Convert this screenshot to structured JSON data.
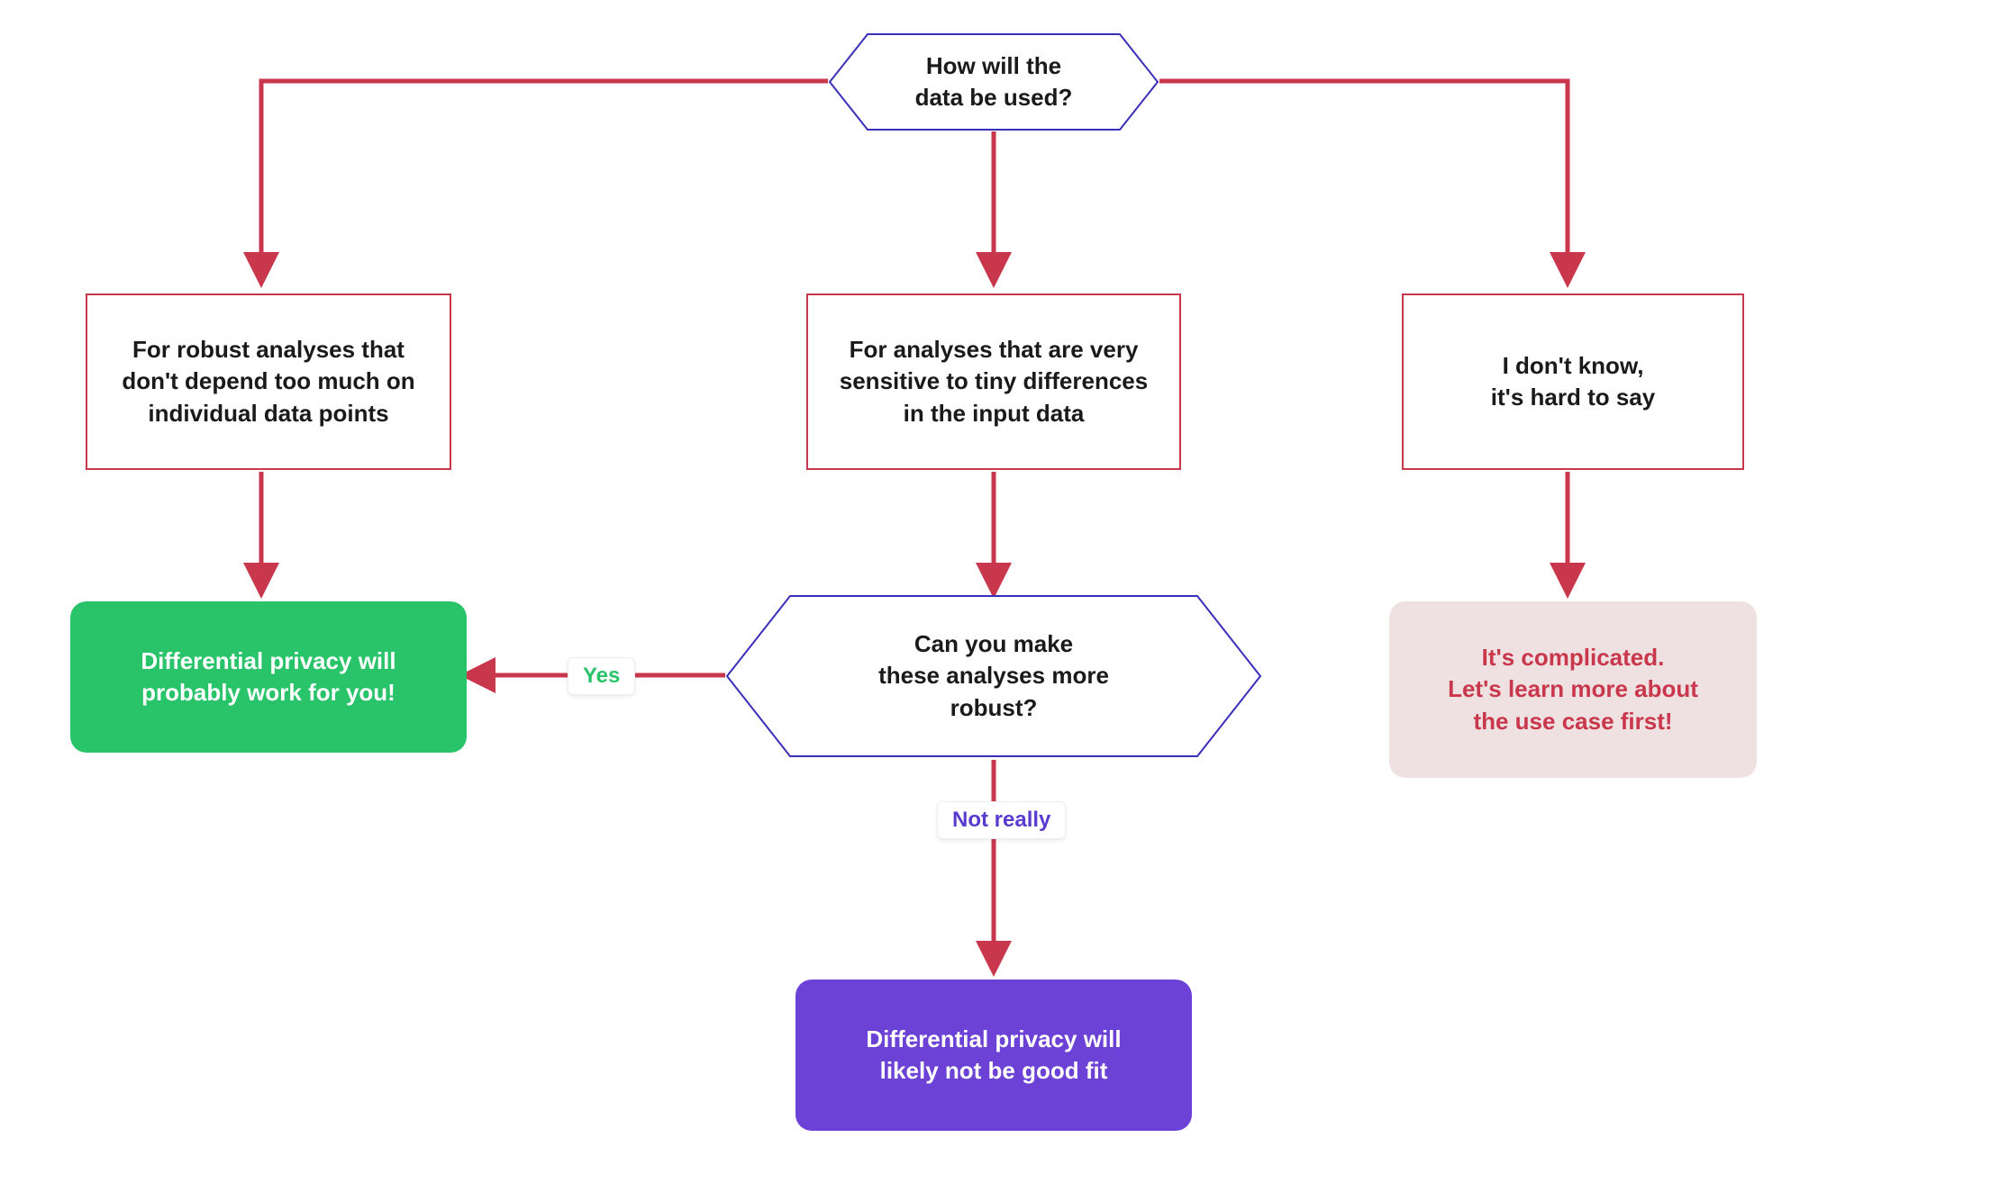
{
  "diagram": {
    "root_decision": "How will the\ndata be used?",
    "branch_left": "For robust analyses that\ndon't depend too much on\nindividual data points",
    "branch_mid": "For analyses that are very\nsensitive to tiny differences\nin the input data",
    "branch_right": "I don't know,\nit's hard to say",
    "mid_decision": "Can you make\nthese analyses more\nrobust?",
    "result_green": "Differential privacy will\nprobably work for you!",
    "result_purple": "Differential privacy will\nlikely not be good fit",
    "result_pink": "It's complicated.\nLet's learn more about\nthe use case first!",
    "label_yes": "Yes",
    "label_no": "Not really"
  },
  "colors": {
    "arrow": "#c9374d",
    "decision_border": "#3a2fba",
    "green": "#29c46a",
    "purple": "#6b41d6",
    "pink_bg": "#efe1e1",
    "pink_text": "#c9374d"
  }
}
